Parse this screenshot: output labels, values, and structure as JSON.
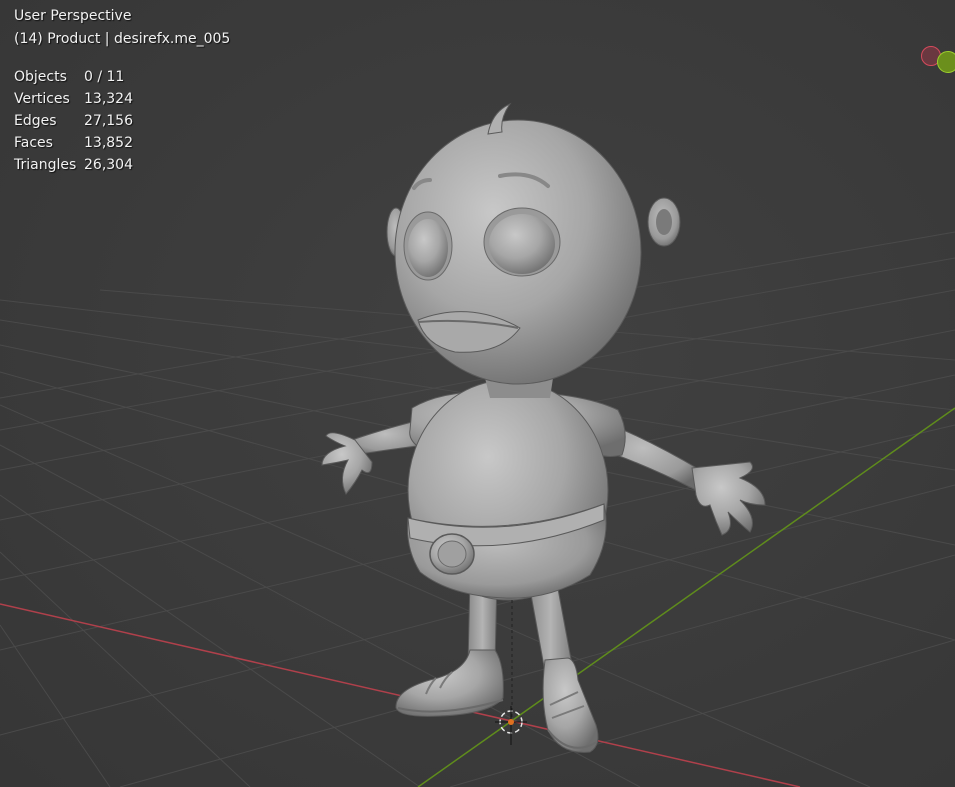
{
  "viewport": {
    "view_name": "User Perspective",
    "collection_info": "(14) Product | desirefx.me_005"
  },
  "stats": [
    {
      "label": "Objects",
      "value": "0 / 11"
    },
    {
      "label": "Vertices",
      "value": "13,324"
    },
    {
      "label": "Edges",
      "value": "27,156"
    },
    {
      "label": "Faces",
      "value": "13,852"
    },
    {
      "label": "Triangles",
      "value": "26,304"
    }
  ],
  "gizmo": {
    "x_axis_color": "#d64a5c",
    "y_axis_color": "#9ccf2e"
  },
  "colors": {
    "background": "#393939",
    "grid": "#4a4a4a",
    "x_axis_line": "#b0404b",
    "y_axis_line": "#5f8c1c",
    "model": "#a8a8a8",
    "cursor": "#e07020"
  }
}
